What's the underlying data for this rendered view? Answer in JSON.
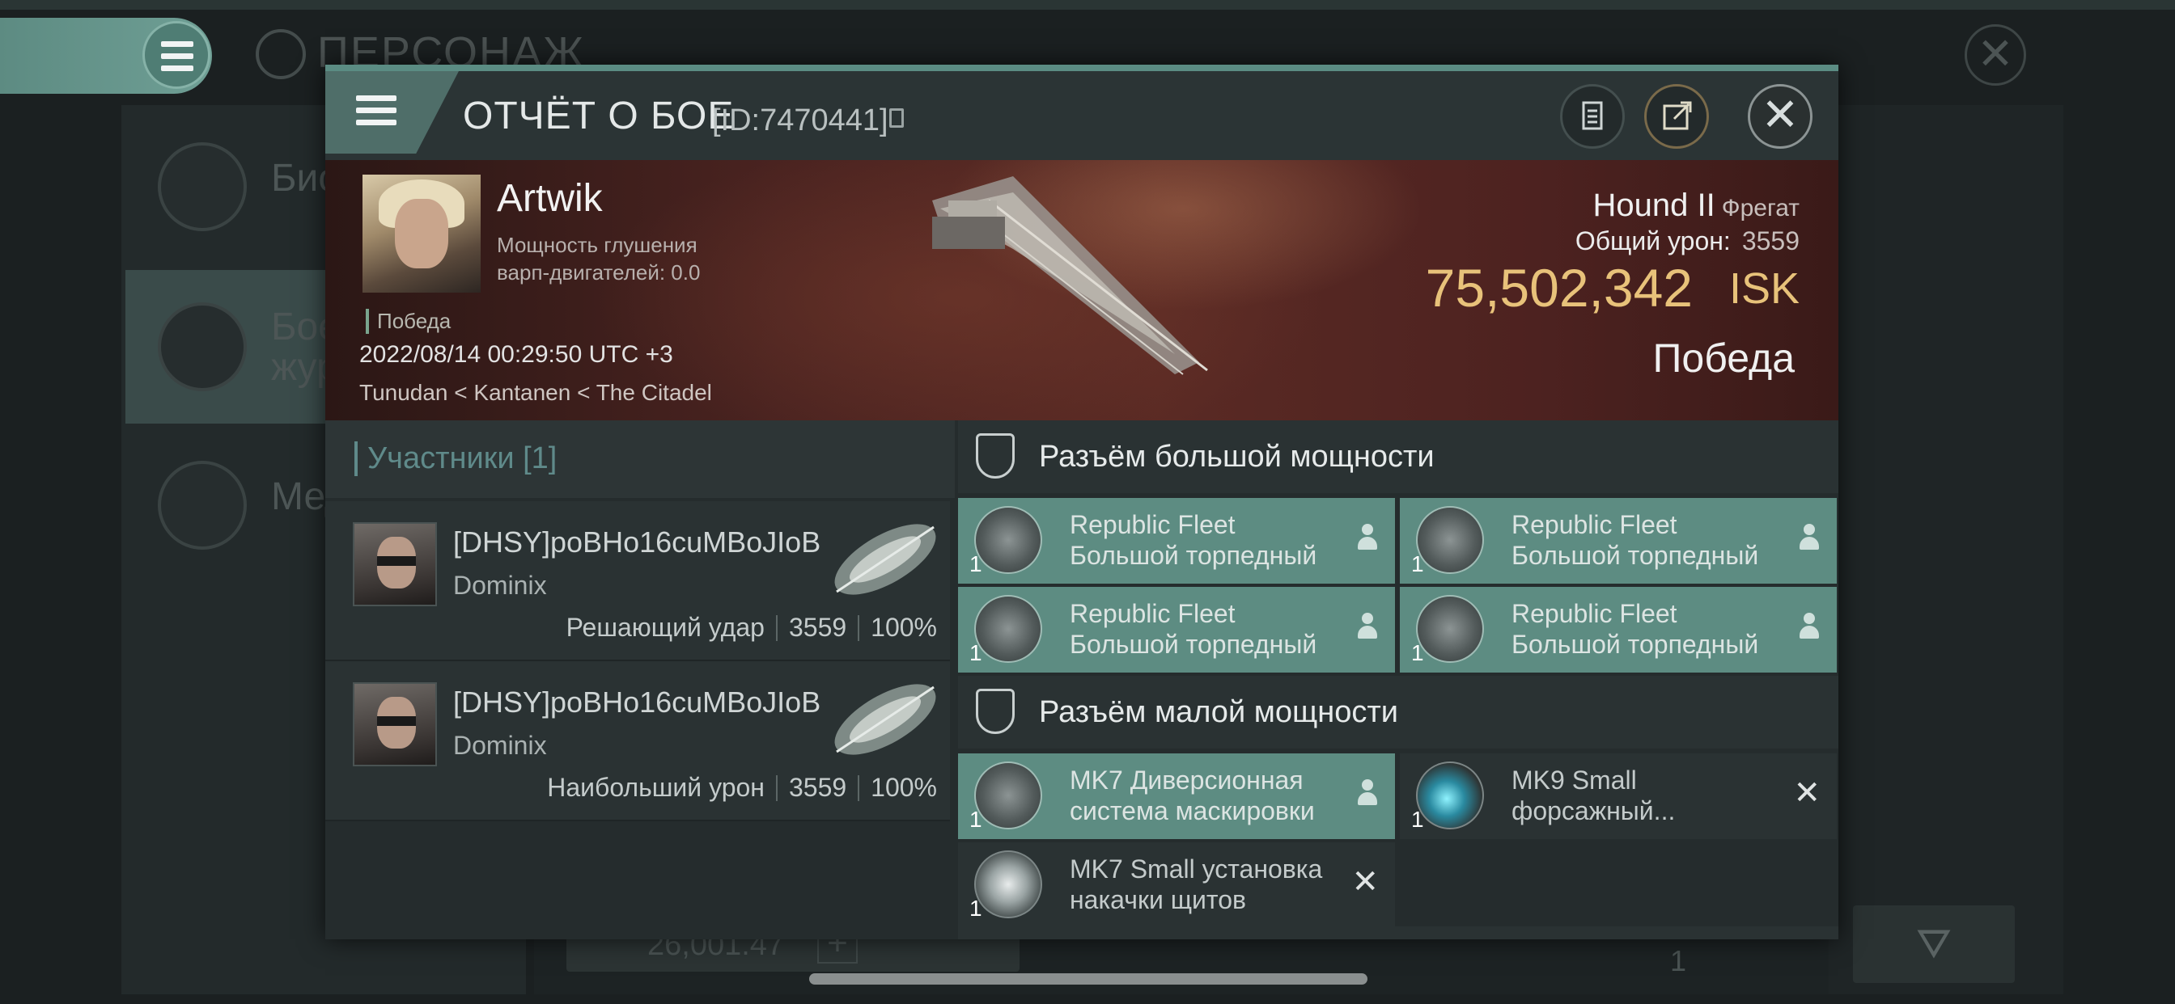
{
  "background": {
    "title": "ПЕРСОНАЖ",
    "left_items": [
      {
        "label": "Био"
      },
      {
        "label": "Бое\nжур"
      },
      {
        "label": "Мед"
      }
    ],
    "bottom_value": "26,001.47",
    "bottom_plus": "+",
    "bottom_count": "1"
  },
  "modal": {
    "title": "ОТЧЁТ О БОЕ",
    "report_id": "[ID:7470441]"
  },
  "victim": {
    "name": "Artwik",
    "warp_label": "Мощность глушения\nварп-двигателей: 0.0",
    "result_tag": "Победа",
    "time": "2022/08/14 00:29:50 UTC +3",
    "location": "Tunudan < Kantanen < The Citadel",
    "ship_name": "Hound II",
    "ship_class": "Фрегат",
    "total_damage_label": "Общий урон:",
    "total_damage": "3559",
    "isk_value": "75,502,342",
    "isk_unit": "ISK",
    "outcome": "Победа"
  },
  "participants": {
    "title": "Участники [1]",
    "rows": [
      {
        "name": "[DHSY]poBHo16cuMBoJIoB",
        "ship": "Dominix",
        "role": "Решающий удар",
        "damage": "3559",
        "percent": "100%"
      },
      {
        "name": "[DHSY]poBHo16cuMBoJIoB",
        "ship": "Dominix",
        "role": "Наибольший урон",
        "damage": "3559",
        "percent": "100%"
      }
    ]
  },
  "fittings": {
    "high_title": "Разъём большой мощности",
    "high": [
      {
        "qty": "1",
        "text": "Republic Fleet\nБольшой торпедный ..."
      },
      {
        "qty": "1",
        "text": "Republic Fleet\nБольшой торпедный ..."
      },
      {
        "qty": "1",
        "text": "Republic Fleet\nБольшой торпедный ..."
      },
      {
        "qty": "1",
        "text": "Republic Fleet\nБольшой торпедный ..."
      }
    ],
    "low_title": "Разъём малой мощности",
    "low": [
      {
        "qty": "1",
        "text": "MK7 Диверсионная\nсистема маскировки"
      },
      {
        "qty": "1",
        "text": "MK9 Small\nфорсажный..."
      },
      {
        "qty": "1",
        "text": "MK7 Small установка\nнакачки щитов"
      }
    ]
  },
  "colors": {
    "accent": "#5d8c82",
    "isk": "#e8c27a",
    "banner": "#4a2320"
  },
  "icons": [
    "menu-icon",
    "notes-icon",
    "share-icon",
    "close-icon",
    "copy-icon",
    "shield-icon",
    "person-icon",
    "filter-icon"
  ]
}
